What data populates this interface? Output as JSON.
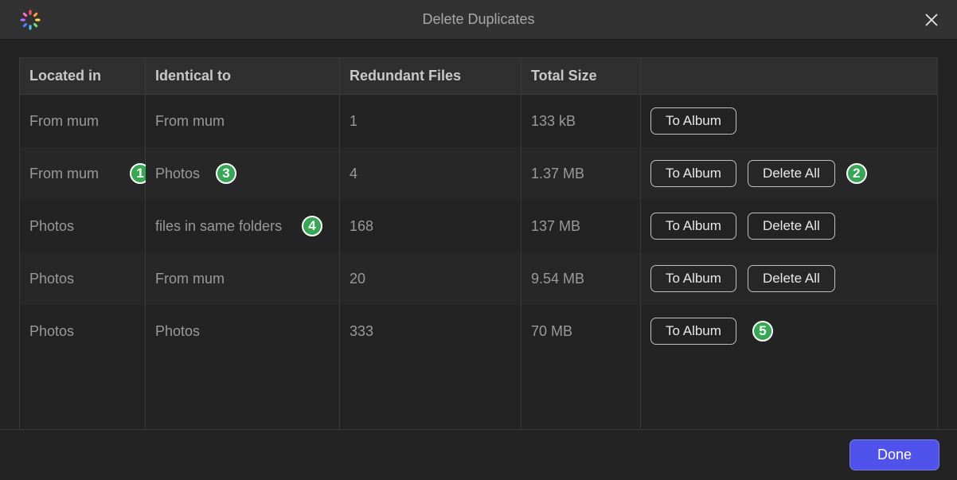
{
  "window": {
    "title": "Delete Duplicates"
  },
  "table": {
    "headers": {
      "located_in": "Located in",
      "identical_to": "Identical to",
      "redundant": "Redundant Files",
      "total_size": "Total Size"
    },
    "rows": [
      {
        "located_in": "From mum",
        "identical_to": "From mum",
        "redundant": "1",
        "total_size": "133 kB",
        "to_album": "To Album",
        "delete_all": ""
      },
      {
        "located_in": "From mum",
        "identical_to": "Photos",
        "redundant": "4",
        "total_size": "1.37 MB",
        "to_album": "To Album",
        "delete_all": "Delete All"
      },
      {
        "located_in": "Photos",
        "identical_to": "files in same folders",
        "redundant": "168",
        "total_size": "137 MB",
        "to_album": "To Album",
        "delete_all": "Delete All"
      },
      {
        "located_in": "Photos",
        "identical_to": "From mum",
        "redundant": "20",
        "total_size": "9.54 MB",
        "to_album": "To Album",
        "delete_all": "Delete All"
      },
      {
        "located_in": "Photos",
        "identical_to": "Photos",
        "redundant": "333",
        "total_size": "70 MB",
        "to_album": "To Album",
        "delete_all": ""
      }
    ]
  },
  "buttons": {
    "done": "Done"
  },
  "markers": {
    "m1": "1",
    "m2": "2",
    "m3": "3",
    "m4": "4",
    "m5": "5"
  }
}
